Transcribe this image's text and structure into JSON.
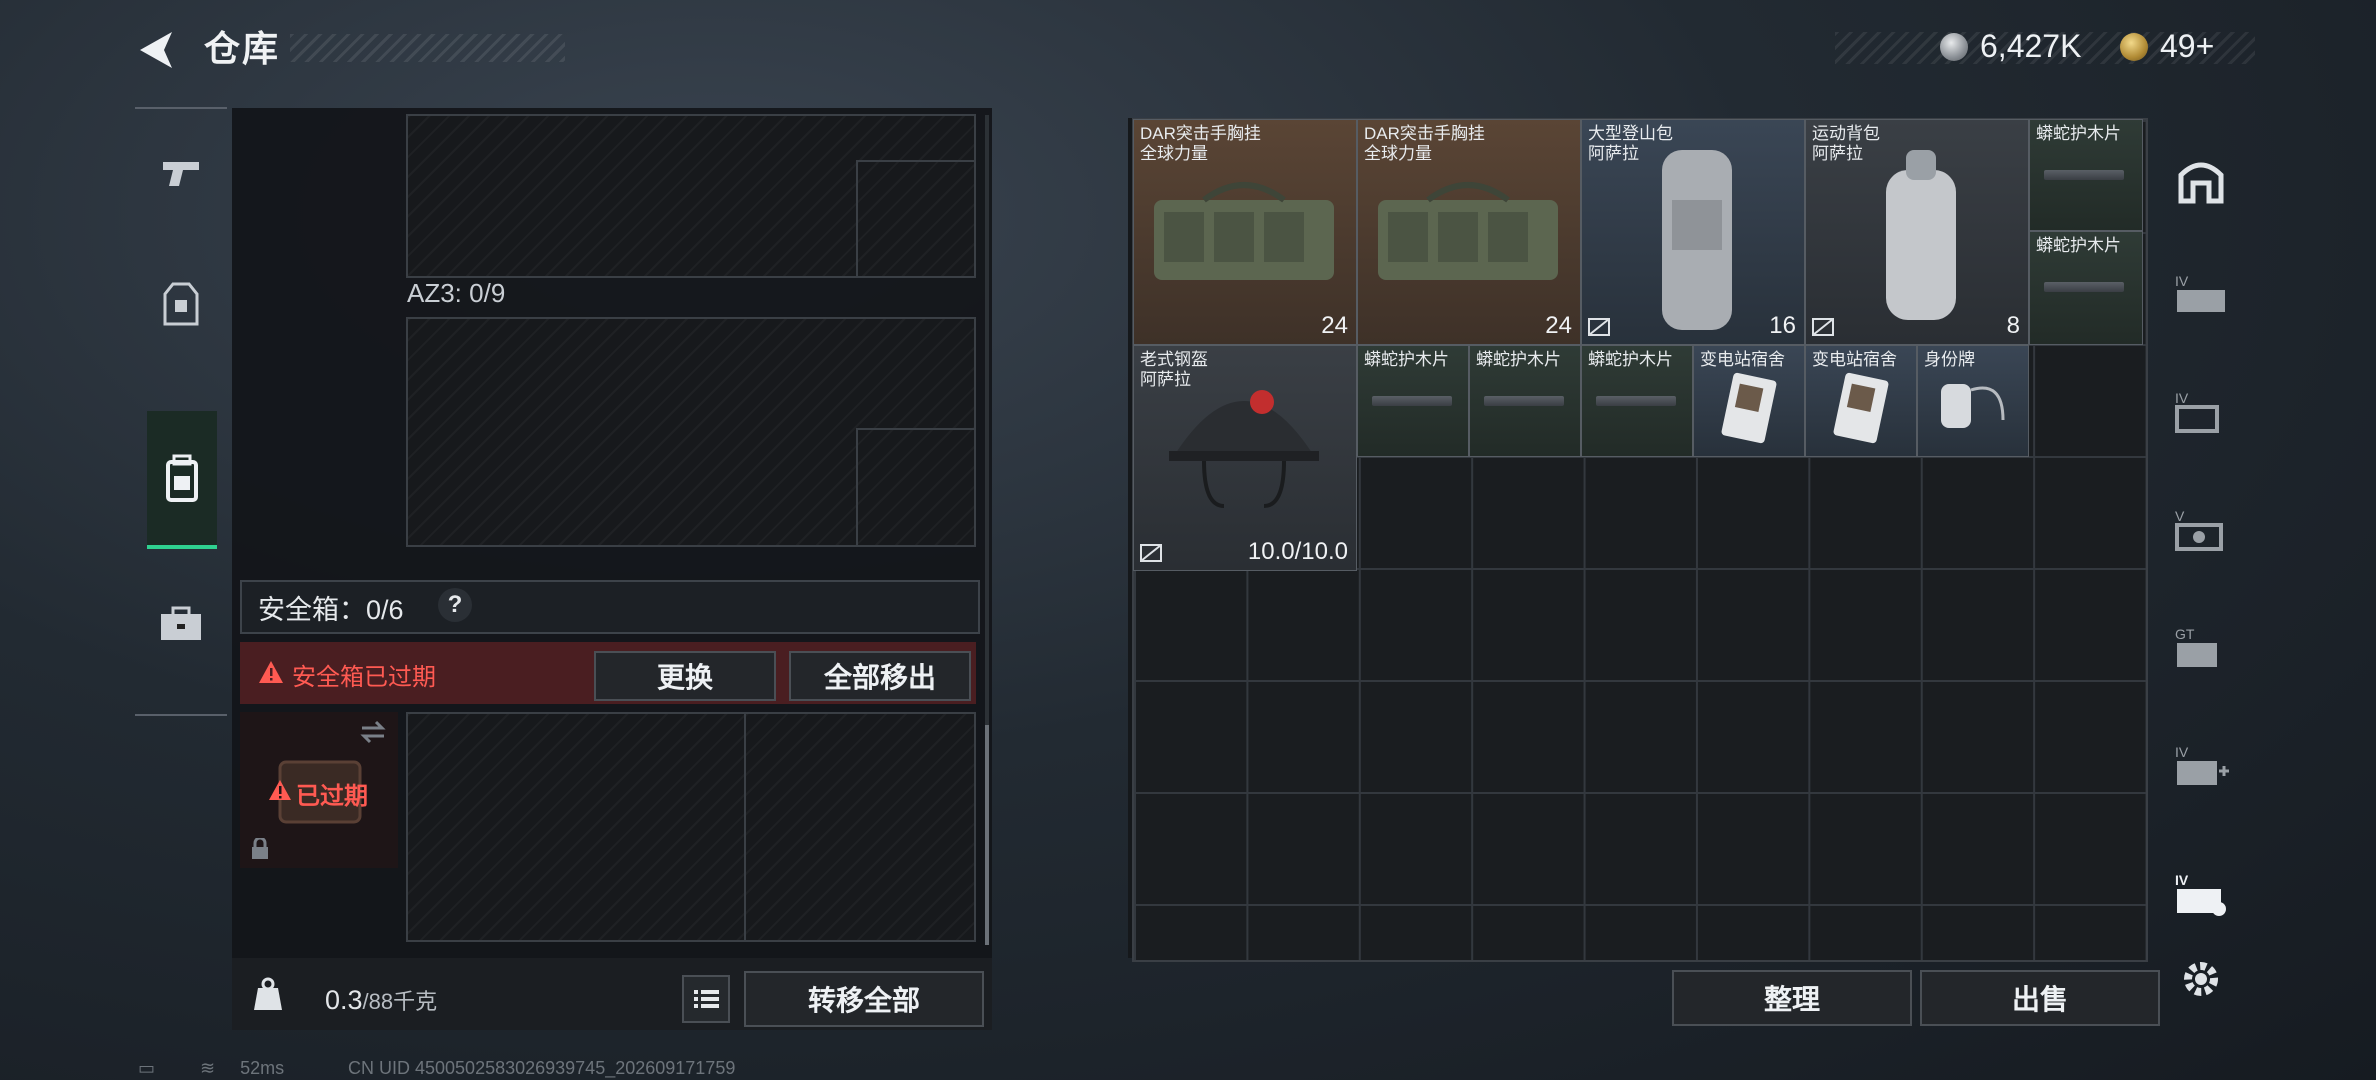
{
  "header": {
    "title": "仓库",
    "currency_silver": "6,427K",
    "currency_gold": "49+"
  },
  "left_tabs": [
    {
      "name": "weapons-tab",
      "icon": "pistol-icon",
      "active": false
    },
    {
      "name": "armor-tab",
      "icon": "vest-icon",
      "active": false
    },
    {
      "name": "backpack-tab",
      "icon": "backpack-icon",
      "active": true
    },
    {
      "name": "case-tab",
      "icon": "briefcase-icon",
      "active": false
    }
  ],
  "loadout": {
    "az3_label": "AZ3: 0/9",
    "safe_box_label": "安全箱：0/6",
    "help_label": "?",
    "expired_warning": "安全箱已过期",
    "replace_label": "更换",
    "remove_all_label": "全部移出",
    "safe_box_expired": "已过期"
  },
  "bottom_left": {
    "weight_value": "0.3",
    "weight_max": "/88千克",
    "transfer_all_label": "转移全部"
  },
  "inventory": {
    "items": [
      {
        "id": "dar-1",
        "name": "DAR突击手胸挂",
        "sub": "全球力量",
        "count": "24",
        "rarity_color": "#5a4535"
      },
      {
        "id": "dar-2",
        "name": "DAR突击手胸挂",
        "sub": "全球力量",
        "count": "24",
        "rarity_color": "#5a4535"
      },
      {
        "id": "mountain-bag",
        "name": "大型登山包",
        "sub": "阿萨拉",
        "count": "16",
        "rarity_color": "#3a4655"
      },
      {
        "id": "sport-bag",
        "name": "运动背包",
        "sub": "阿萨拉",
        "count": "8",
        "rarity_color": "#3a3f45"
      },
      {
        "id": "plank-1",
        "name": "蟒蛇护木片"
      },
      {
        "id": "plank-2",
        "name": "蟒蛇护木片"
      },
      {
        "id": "helmet",
        "name": "老式钢盔",
        "sub": "阿萨拉",
        "count": "10.0/10.0"
      },
      {
        "id": "plank-3",
        "name": "蟒蛇护木片"
      },
      {
        "id": "plank-4",
        "name": "蟒蛇护木片"
      },
      {
        "id": "plank-5",
        "name": "蟒蛇护木片"
      },
      {
        "id": "card-1",
        "name": "变电站宿舍"
      },
      {
        "id": "card-2",
        "name": "变电站宿舍"
      },
      {
        "id": "dogtag",
        "name": "身份牌"
      }
    ],
    "sort_label": "整理",
    "sell_label": "出售"
  },
  "right_tools": [
    "home-icon",
    "storage-iv-icon",
    "storage-iv-2-icon",
    "storage-v-icon",
    "storage-gt-icon",
    "storage-add-icon",
    "storage-iv-active-icon",
    "settings-gear-icon"
  ],
  "status_bar": {
    "ping": "52ms",
    "uid": "CN UID 4500502583026939745_202609171759"
  }
}
